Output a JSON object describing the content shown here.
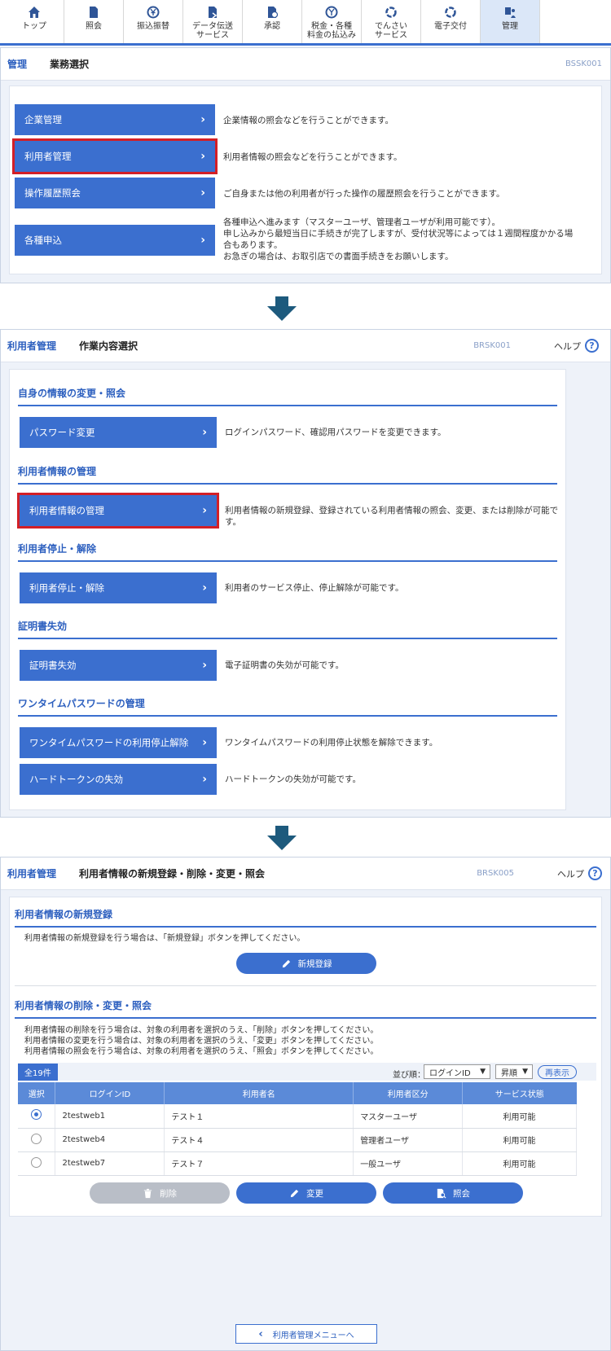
{
  "nav": [
    {
      "label": "トップ",
      "icon": "home-icon"
    },
    {
      "label": "照会",
      "icon": "document-icon"
    },
    {
      "label": "振込振替",
      "icon": "yen-transfer-icon"
    },
    {
      "label": "データ伝送\nサービス",
      "icon": "data-transfer-icon"
    },
    {
      "label": "承認",
      "icon": "approve-icon"
    },
    {
      "label": "税金・各種\n料金の払込み",
      "icon": "tax-payment-icon"
    },
    {
      "label": "でんさい\nサービス",
      "icon": "densai-icon"
    },
    {
      "label": "電子交付",
      "icon": "e-delivery-icon"
    },
    {
      "label": "管理",
      "icon": "admin-icon"
    }
  ],
  "screen1": {
    "section": "管理",
    "title": "業務選択",
    "code": "BSSK001",
    "items": [
      {
        "label": "企業管理",
        "desc": "企業情報の照会などを行うことができます。"
      },
      {
        "label": "利用者管理",
        "desc": "利用者情報の照会などを行うことができます。"
      },
      {
        "label": "操作履歴照会",
        "desc": "ご自身または他の利用者が行った操作の履歴照会を行うことができます。"
      },
      {
        "label": "各種申込",
        "desc1": "各種申込へ進みます（マスターユーザ、管理者ユーザが利用可能です）。",
        "desc2": "申し込みから最短当日に手続きが完了しますが、受付状況等によっては１週間程度かかる場",
        "desc3": "合もあります。",
        "desc4": "お急ぎの場合は、お取引店での書面手続きをお願いします。"
      }
    ]
  },
  "screen2": {
    "section": "利用者管理",
    "title": "作業内容選択",
    "code": "BRSK001",
    "help": "ヘルプ",
    "headings": [
      "自身の情報の変更・照会",
      "利用者情報の管理",
      "利用者停止・解除",
      "証明書失効",
      "ワンタイムパスワードの管理"
    ],
    "buttons": [
      {
        "label": "パスワード変更",
        "desc": "ログインパスワード、確認用パスワードを変更できます。"
      },
      {
        "label": "利用者情報の管理",
        "desc": "利用者情報の新規登録、登録されている利用者情報の照会、変更、または削除が可能です。"
      },
      {
        "label": "利用者停止・解除",
        "desc": "利用者のサービス停止、停止解除が可能です。"
      },
      {
        "label": "証明書失効",
        "desc": "電子証明書の失効が可能です。"
      },
      {
        "label": "ワンタイムパスワードの利用停止解除",
        "desc": "ワンタイムパスワードの利用停止状態を解除できます。"
      },
      {
        "label": "ハードトークンの失効",
        "desc": "ハードトークンの失効が可能です。"
      }
    ]
  },
  "screen3": {
    "section": "利用者管理",
    "title": "利用者情報の新規登録・削除・変更・照会",
    "code": "BRSK005",
    "help": "ヘルプ",
    "new_heading": "利用者情報の新規登録",
    "new_text": "利用者情報の新規登録を行う場合は、「新規登録」ボタンを押してください。",
    "new_button": "新規登録",
    "edit_heading": "利用者情報の削除・変更・照会",
    "edit_text1": "利用者情報の削除を行う場合は、対象の利用者を選択のうえ、「削除」ボタンを押してください。",
    "edit_text2": "利用者情報の変更を行う場合は、対象の利用者を選択のうえ、「変更」ボタンを押してください。",
    "edit_text3": "利用者情報の照会を行う場合は、対象の利用者を選択のうえ、「照会」ボタンを押してください。",
    "count": "全19件",
    "sort_label": "並び順：",
    "sort_key": "ログインID",
    "sort_order": "昇順",
    "redisplay": "再表示",
    "columns": [
      "選択",
      "ログインID",
      "利用者名",
      "利用者区分",
      "サービス状態"
    ],
    "rows": [
      {
        "id": "2testweb1",
        "name": "テスト１",
        "type": "マスターユーザ",
        "status": "利用可能",
        "selected": true
      },
      {
        "id": "2testweb4",
        "name": "テスト４",
        "type": "管理者ユーザ",
        "status": "利用可能",
        "selected": false
      },
      {
        "id": "2testweb7",
        "name": "テスト７",
        "type": "一般ユーザ",
        "status": "利用可能",
        "selected": false
      }
    ],
    "delete_button": "削除",
    "change_button": "変更",
    "inquiry_button": "照会",
    "back_button": "利用者管理メニューへ"
  },
  "colors": {
    "primary": "#3b6fcf",
    "highlight": "#d31f26",
    "arrow": "#1d5a7d"
  }
}
